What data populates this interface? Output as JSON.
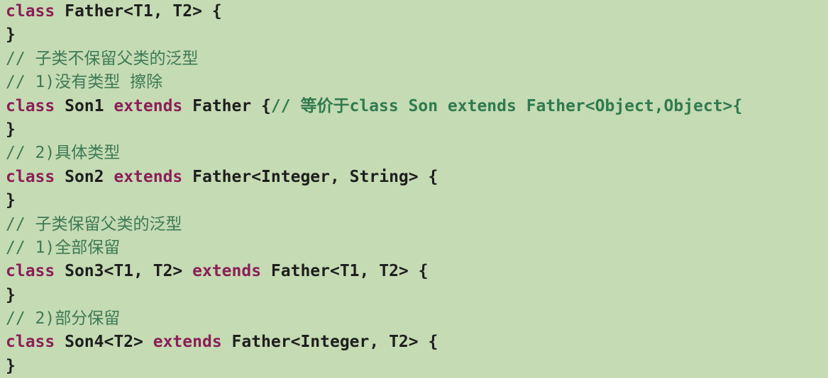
{
  "code": {
    "line1": {
      "kw": "class",
      "rest": " Father<T1, T2> {"
    },
    "line2": {
      "text": "}"
    },
    "line3": {
      "comment": "// 子类不保留父类的泛型"
    },
    "line4": {
      "comment": "// 1)没有类型 擦除"
    },
    "line5": {
      "kw1": "class",
      "mid1": " Son1 ",
      "kw2": "extends",
      "mid2": " Father {",
      "comment": "// 等价于class Son extends Father<Object,Object>{"
    },
    "line6": {
      "text": "}"
    },
    "line7": {
      "comment": "// 2)具体类型"
    },
    "line8": {
      "kw1": "class",
      "mid1": " Son2 ",
      "kw2": "extends",
      "rest": " Father<Integer, String> {"
    },
    "line9": {
      "text": "}"
    },
    "line10": {
      "comment": "// 子类保留父类的泛型"
    },
    "line11": {
      "comment": "// 1)全部保留"
    },
    "line12": {
      "kw1": "class",
      "mid1": " Son3<T1, T2> ",
      "kw2": "extends",
      "rest": " Father<T1, T2> {"
    },
    "line13": {
      "text": "}"
    },
    "line14": {
      "comment": "// 2)部分保留"
    },
    "line15": {
      "kw1": "class",
      "mid1": " Son4<T2> ",
      "kw2": "extends",
      "rest": " Father<Integer, T2> {"
    },
    "line16": {
      "text": "}"
    }
  },
  "colors": {
    "background": "#c5dbb3",
    "keyword": "#8a1f57",
    "comment": "#3d7a55",
    "text": "#1e1e1e"
  }
}
